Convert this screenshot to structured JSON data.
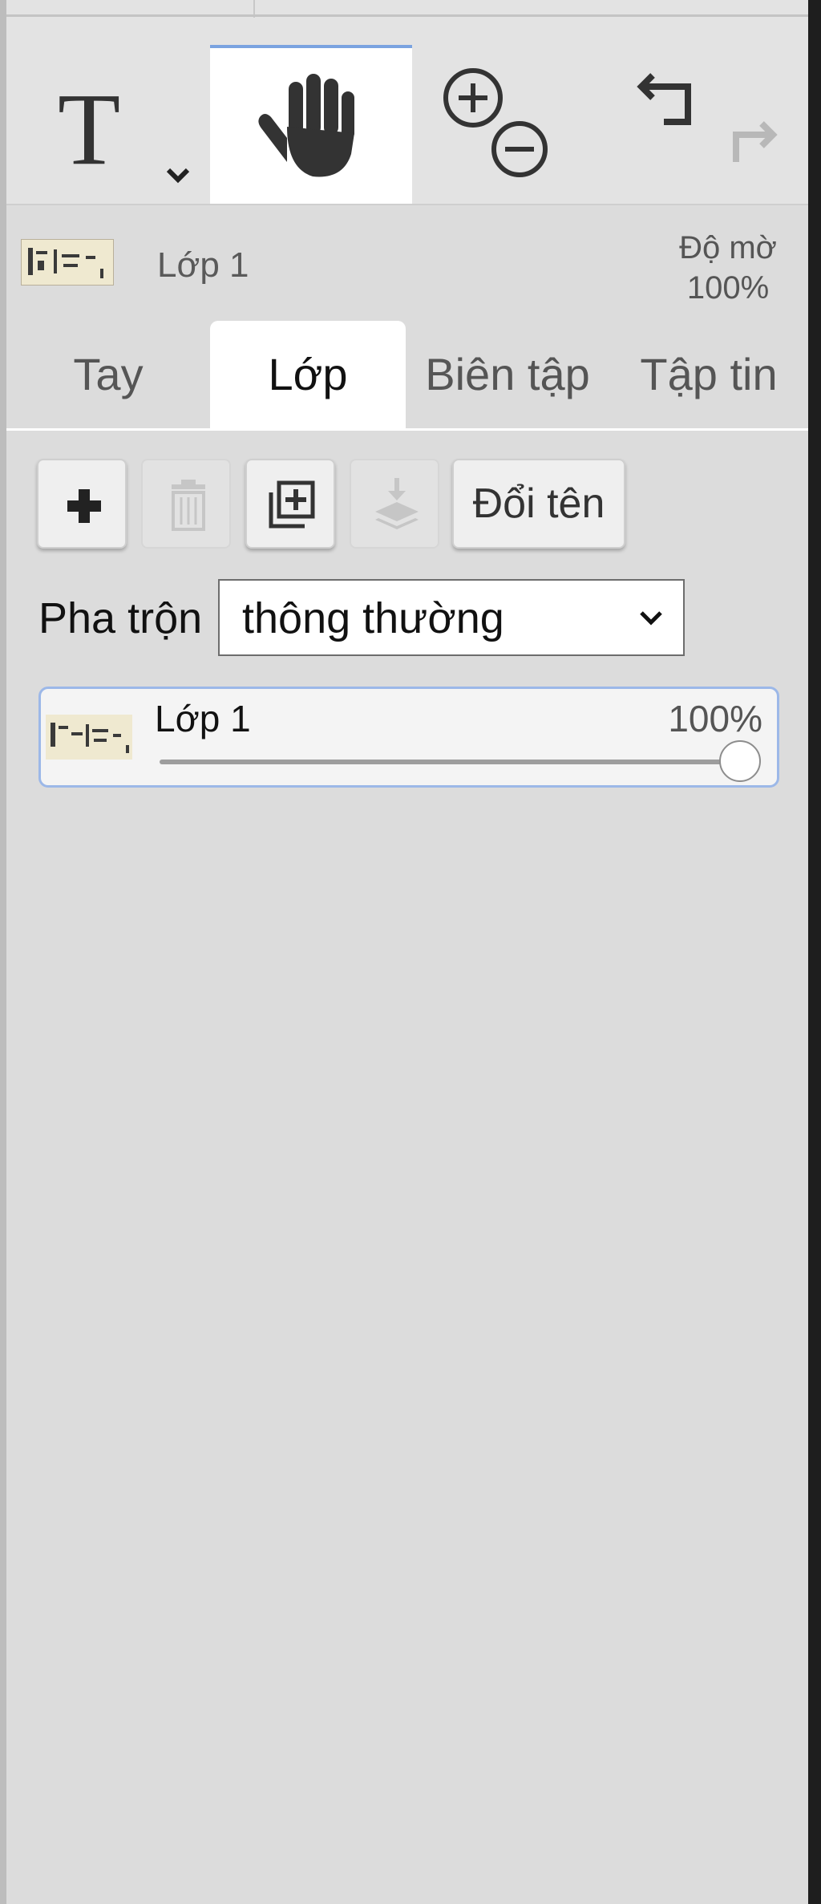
{
  "toolbar": {
    "tools": [
      {
        "name": "text-tool",
        "icon": "text-T-icon",
        "has_dropdown": true
      },
      {
        "name": "pan-tool",
        "icon": "hand-icon",
        "active": true
      },
      {
        "name": "zoom-tool",
        "icon": "zoom-in-out-icon"
      },
      {
        "name": "history-tool",
        "icon": "undo-redo-icon"
      }
    ]
  },
  "layer_info": {
    "name": "Lớp 1",
    "opacity_label": "Độ mờ",
    "opacity_value": "100%"
  },
  "tabs": [
    {
      "label": "Tay",
      "active": false
    },
    {
      "label": "Lớp",
      "active": true
    },
    {
      "label": "Biên tập",
      "active": false
    },
    {
      "label": "Tập tin",
      "active": false
    }
  ],
  "actions": {
    "add_icon": "plus-icon",
    "delete_icon": "trash-icon",
    "duplicate_icon": "duplicate-layer-icon",
    "merge_icon": "merge-down-icon",
    "rename_label": "Đổi tên"
  },
  "blend": {
    "label": "Pha trộn",
    "value": "thông thường"
  },
  "layers": [
    {
      "name": "Lớp 1",
      "opacity": "100%",
      "opacity_fraction": 1.0
    }
  ],
  "colors": {
    "panel_bg": "#dcdcdc",
    "active_tab_bg": "#ffffff",
    "selection_border": "#9cb8e8",
    "active_tool_accent": "#7aa3e0"
  }
}
